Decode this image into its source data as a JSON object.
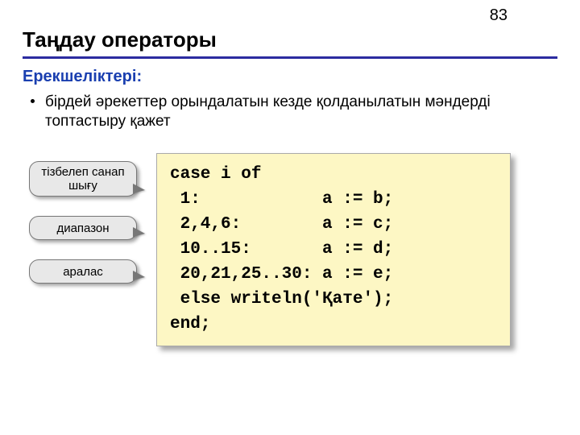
{
  "page_number": "83",
  "title": "Таңдау операторы",
  "subtitle": "Ерекшеліктері:",
  "bullet": "бірдей әрекеттер орындалатын кезде қолданылатын мәндерді топтастыру қажет",
  "callouts": {
    "c1": "тізбелеп санап шығу",
    "c2": "диапазон",
    "c3": "аралас"
  },
  "code": "case i of\n 1:            a := b;\n 2,4,6:        a := c;\n 10..15:       a := d;\n 20,21,25..30: a := e;\n else writeln('Қате');\nend;"
}
